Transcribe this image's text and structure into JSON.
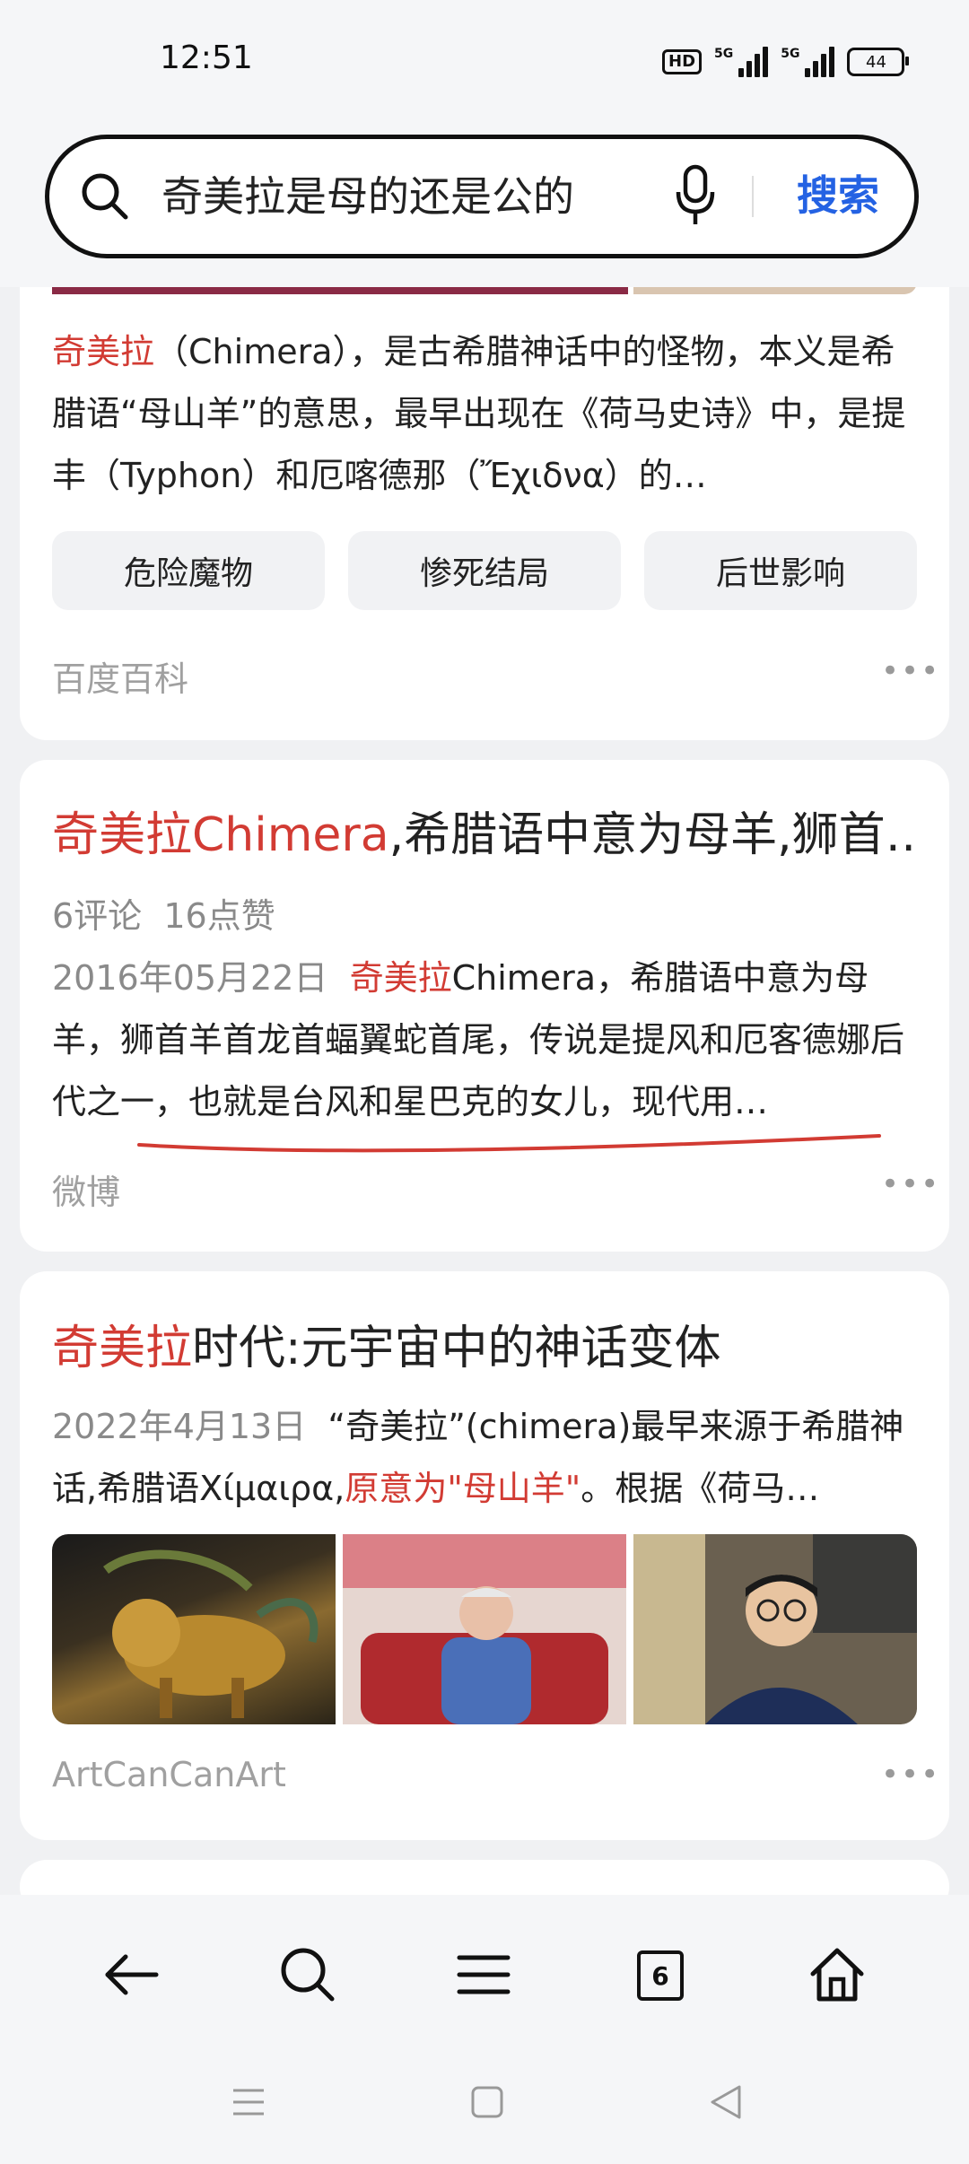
{
  "status_bar": {
    "time": "12:51",
    "hd": "HD",
    "net1": "5G",
    "net2": "5G",
    "battery": "44"
  },
  "search": {
    "query": "奇美拉是母的还是公的",
    "button": "搜索"
  },
  "card1": {
    "text_red": "奇美拉",
    "text_rest": "（Chimera），是古希腊神话中的怪物，本义是希腊语“母山羊”的意思，最早出现在《荷马史诗》中，是提丰（Typhon）和厄喀德那（Ἔχιδνα）的…",
    "chips": [
      "危险魔物",
      "惨死结局",
      "后世影响"
    ],
    "source": "百度百科"
  },
  "card2": {
    "title_red": "奇美拉Chimera",
    "title_rest": ",希腊语中意为母羊,狮首…",
    "meta": "6评论  16点赞",
    "date": "2016年05月22日",
    "text_red": "奇美拉",
    "text_rest": "Chimera，希腊语中意为母羊，狮首羊首龙首蝠翼蛇首尾，传说是提风和厄客德娜后代之一，也就是台风和星巴克的女儿，现代用…",
    "source": "微博"
  },
  "card3": {
    "title_red": "奇美拉",
    "title_rest": "时代:元宇宙中的神话变体",
    "date": "2022年4月13日",
    "text_a": "“奇美拉”(chimera)最早来源于希腊神话,希腊语Χίμαιρα,",
    "text_red": "原意为\"母山羊\"",
    "text_b": "。根据《荷马…",
    "source": "ArtCanCanArt"
  },
  "nav": {
    "tabs_count": "6"
  },
  "colors": {
    "accent_blue": "#2462e3",
    "highlight_red": "#d23b33"
  }
}
